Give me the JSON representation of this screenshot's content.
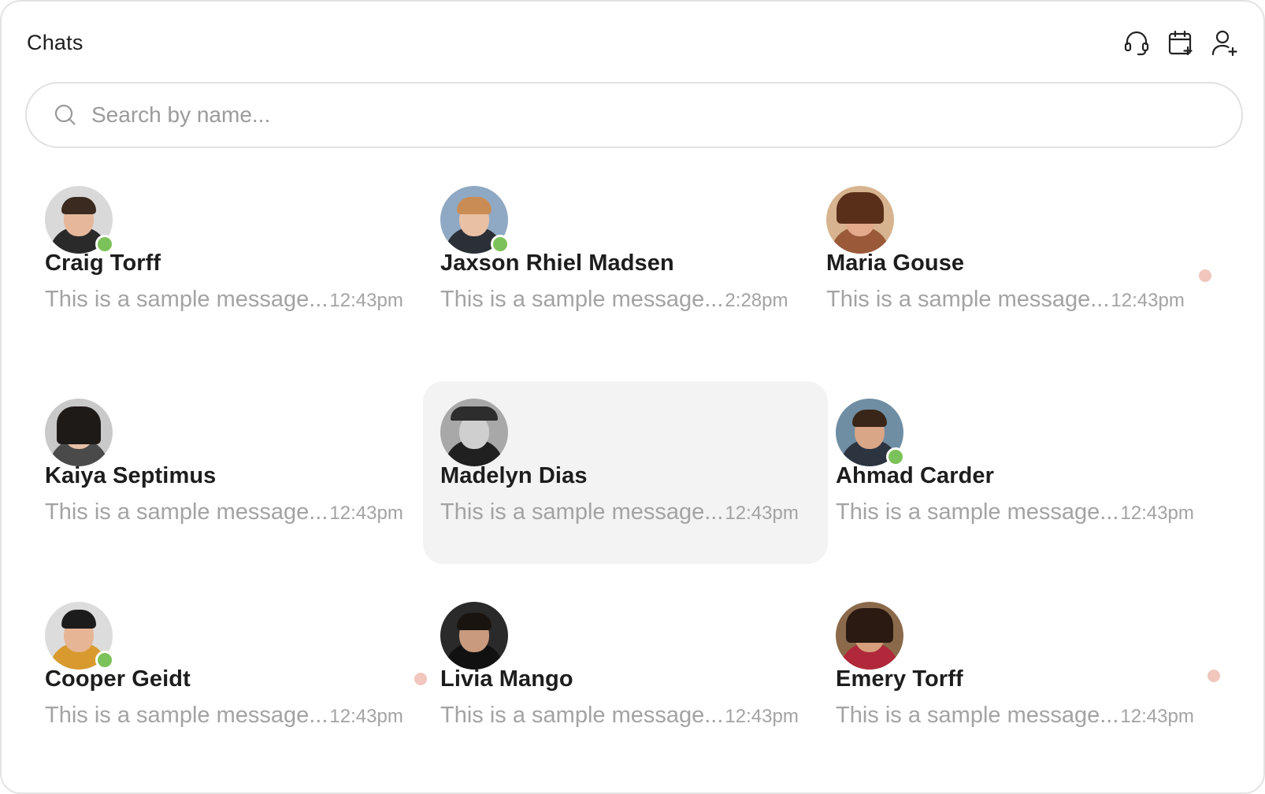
{
  "header": {
    "title": "Chats",
    "actions": [
      "headset-icon",
      "calendar-add-icon",
      "user-add-icon"
    ]
  },
  "search": {
    "placeholder": "Search by name..."
  },
  "chats": [
    {
      "name": "Craig Torff",
      "message": "This is a sample message...",
      "time": "12:43pm",
      "online": true,
      "unread": false,
      "selected": false
    },
    {
      "name": "Jaxson Rhiel Madsen",
      "message": "This is a sample message...",
      "time": "2:28pm",
      "online": true,
      "unread": false,
      "selected": false
    },
    {
      "name": "Maria Gouse",
      "message": "This is a sample message...",
      "time": "12:43pm",
      "online": false,
      "unread": true,
      "selected": false
    },
    {
      "name": "Kaiya Septimus",
      "message": "This is a sample message...",
      "time": "12:43pm",
      "online": false,
      "unread": false,
      "selected": false
    },
    {
      "name": "Madelyn Dias",
      "message": "This is a sample message...",
      "time": "12:43pm",
      "online": false,
      "unread": false,
      "selected": true
    },
    {
      "name": "Ahmad Carder",
      "message": "This is a sample message...",
      "time": "12:43pm",
      "online": true,
      "unread": false,
      "selected": false
    },
    {
      "name": "Cooper Geidt",
      "message": "This is a sample message...",
      "time": "12:43pm",
      "online": true,
      "unread": true,
      "selected": false
    },
    {
      "name": "Livia Mango",
      "message": "This is a sample message...",
      "time": "12:43pm",
      "online": false,
      "unread": false,
      "selected": false
    },
    {
      "name": "Emery Torff",
      "message": "This is a sample message...",
      "time": "12:43pm",
      "online": false,
      "unread": true,
      "selected": false
    }
  ],
  "colors": {
    "online": "#7cc25a",
    "unread": "#f0c6bd",
    "selected_bg": "#f3f3f3",
    "muted_text": "#a3a3a3"
  }
}
